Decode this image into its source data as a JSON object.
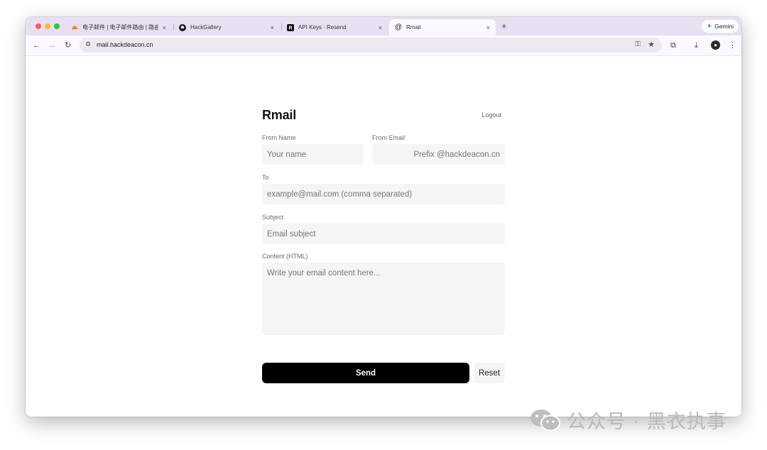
{
  "browser": {
    "tabs": [
      {
        "label": "电子邮件 | 电子邮件路由 | 路由",
        "favicon": "cloudflare-icon",
        "close": "×"
      },
      {
        "label": "HackGallery",
        "favicon": "github-icon",
        "close": "×"
      },
      {
        "label": "API Keys · Resend",
        "favicon": "resend-icon",
        "close": "×"
      },
      {
        "label": "Rmail",
        "favicon": "at-sign-icon",
        "close": "×"
      }
    ],
    "new_tab": "+",
    "gemini_label": "Gemini",
    "url": "mail.hackdeacon.cn",
    "colors": {
      "tabstrip": "#e8dff2",
      "toolbar": "#fbf8ff",
      "omnibox": "#ede8f2"
    }
  },
  "app": {
    "title": "Rmail",
    "logout": "Logout",
    "fields": {
      "from_name": {
        "label": "From Name",
        "placeholder": "Your name"
      },
      "from_email": {
        "label": "From Email",
        "placeholder": "Prefix @hackdeacon.cn"
      },
      "to": {
        "label": "To",
        "placeholder": "example@mail.com (comma separated)"
      },
      "subject": {
        "label": "Subject",
        "placeholder": "Email subject"
      },
      "content": {
        "label": "Content (HTML)",
        "placeholder": "Write your email content here..."
      }
    },
    "send_label": "Send",
    "reset_label": "Reset",
    "colors": {
      "primary_button": "#000000",
      "field_bg": "#f5f5f7"
    }
  },
  "watermark": {
    "text": "公众号 · 黑衣执事"
  }
}
